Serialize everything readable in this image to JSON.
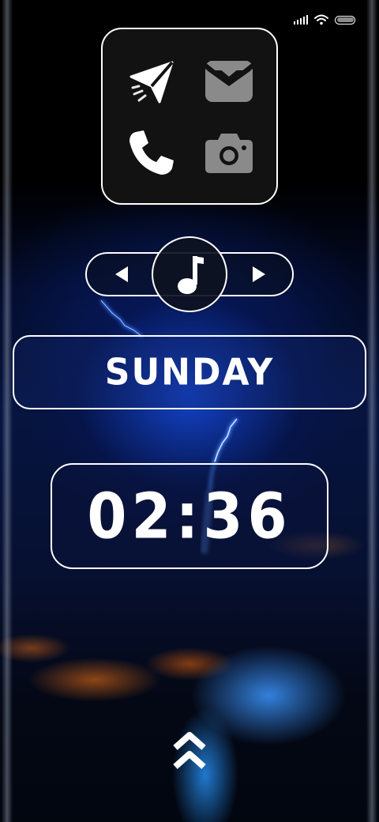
{
  "status_bar": {
    "signal_icon": "signal-icon",
    "wifi_icon": "wifi-icon",
    "battery_icon": "battery-icon"
  },
  "app_widget": {
    "apps": [
      {
        "name": "messages",
        "icon": "paper-plane-icon"
      },
      {
        "name": "mail",
        "icon": "envelope-icon"
      },
      {
        "name": "phone",
        "icon": "phone-icon"
      },
      {
        "name": "camera",
        "icon": "camera-icon"
      }
    ]
  },
  "music_widget": {
    "prev_icon": "previous-track-icon",
    "note_icon": "music-note-icon",
    "next_icon": "next-track-icon"
  },
  "day": {
    "label": "SUNDAY"
  },
  "clock": {
    "time": "02:36"
  },
  "swipe_up_icon": "double-chevron-up-icon",
  "colors": {
    "accent": "#ffffff",
    "widget_bg": "#121212",
    "secondary_icon": "#8a8a8a",
    "wallpaper_blue": "#1446d2"
  }
}
